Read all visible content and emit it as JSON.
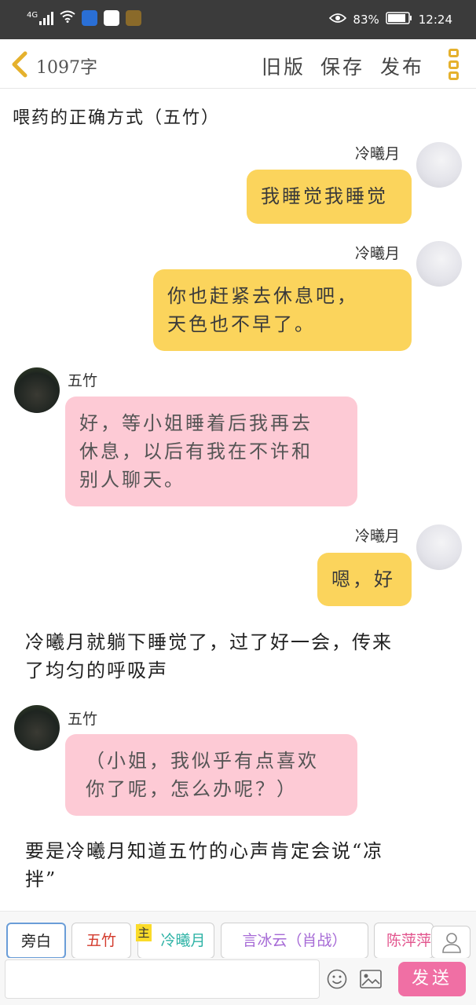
{
  "status": {
    "network": "4G",
    "battery": "83%",
    "time": "12:24"
  },
  "header": {
    "word_count": "1097字",
    "menu": [
      "旧版",
      "保存",
      "发布"
    ]
  },
  "story": {
    "title": "喂药的正确方式（五竹）"
  },
  "messages": [
    {
      "speaker": "冷曦月",
      "text": "我睡觉我睡觉"
    },
    {
      "speaker": "冷曦月",
      "text": "你也赶紧去休息吧，\n天色也不早了。"
    },
    {
      "speaker": "五竹",
      "text": "好，等小姐睡着后我再去\n休息，以后有我在不许和\n别人聊天。"
    },
    {
      "speaker": "冷曦月",
      "text": "嗯，好"
    },
    {
      "speaker": "旁白",
      "text": "冷曦月就躺下睡觉了，过了好一会，传来\n了均匀的呼吸声"
    },
    {
      "speaker": "五竹",
      "text": "（小姐，我似乎有点喜欢\n你了呢，怎么办呢？）"
    },
    {
      "speaker": "旁白",
      "text": "要是冷曦月知道五竹的心声肯定会说“凉\n拌”"
    }
  ],
  "roles": [
    {
      "label": "旁白",
      "color": "#555555"
    },
    {
      "label": "五竹",
      "color": "#d33a2c"
    },
    {
      "label": "冷曦月",
      "color": "#2fb3a6"
    },
    {
      "label": "言冰云（肖战）",
      "color": "#a66ad6"
    },
    {
      "label": "陈萍萍",
      "color": "#e2558e"
    }
  ],
  "main_badge": "主",
  "input": {
    "placeholder": "",
    "send_label": "发送"
  },
  "colors": {
    "self_bubble": "#fbd45c",
    "other_bubble": "#fdcad5",
    "send": "#f06fa4",
    "accent": "#e5b12d"
  }
}
